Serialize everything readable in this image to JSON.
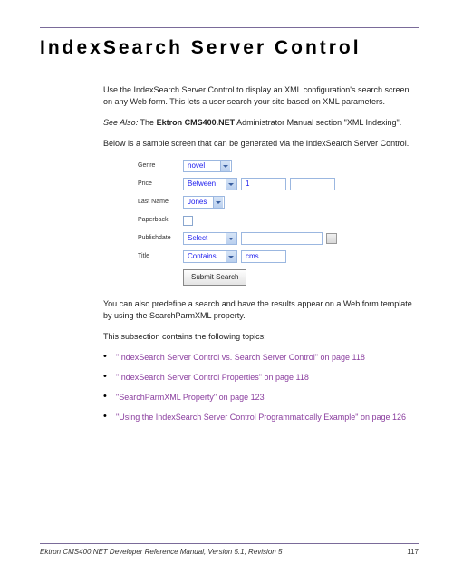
{
  "title": "IndexSearch Server Control",
  "para1": "Use the IndexSearch Server Control to display an XML configuration's search screen on any Web form. This lets a user search your site based on XML parameters.",
  "seeAlsoLabel": "See Also:",
  "seeAlsoText1": " The ",
  "seeAlsoBold": "Ektron CMS400.NET",
  "seeAlsoText2": " Administrator Manual section \"XML Indexing\".",
  "para3": "Below is a sample screen that can be generated via the IndexSearch Server Control.",
  "sample": {
    "rows": [
      {
        "label": "Genre"
      },
      {
        "label": "Price"
      },
      {
        "label": "Last Name"
      },
      {
        "label": "Paperback"
      },
      {
        "label": "Publishdate"
      },
      {
        "label": "Title"
      }
    ],
    "genreSel": "novel",
    "priceSel": "Between",
    "priceVal": "1",
    "lastNameSel": "Jones",
    "publishSel": "Select",
    "titleSel": "Contains",
    "titleVal": "cms",
    "submit": "Submit Search"
  },
  "para4": "You can also predefine a search and have the results appear on a Web form template by using the SearchParmXML property.",
  "para5": "This subsection contains the following topics:",
  "links": [
    "\"IndexSearch Server Control vs. Search Server Control\" on page 118",
    "\"IndexSearch Server Control Properties\" on page 118",
    "\"SearchParmXML Property\" on page 123",
    "\"Using the IndexSearch Server Control Programmatically Example\" on page 126"
  ],
  "footer": {
    "text": "Ektron CMS400.NET Developer Reference Manual, Version 5.1, Revision 5",
    "page": "117"
  }
}
